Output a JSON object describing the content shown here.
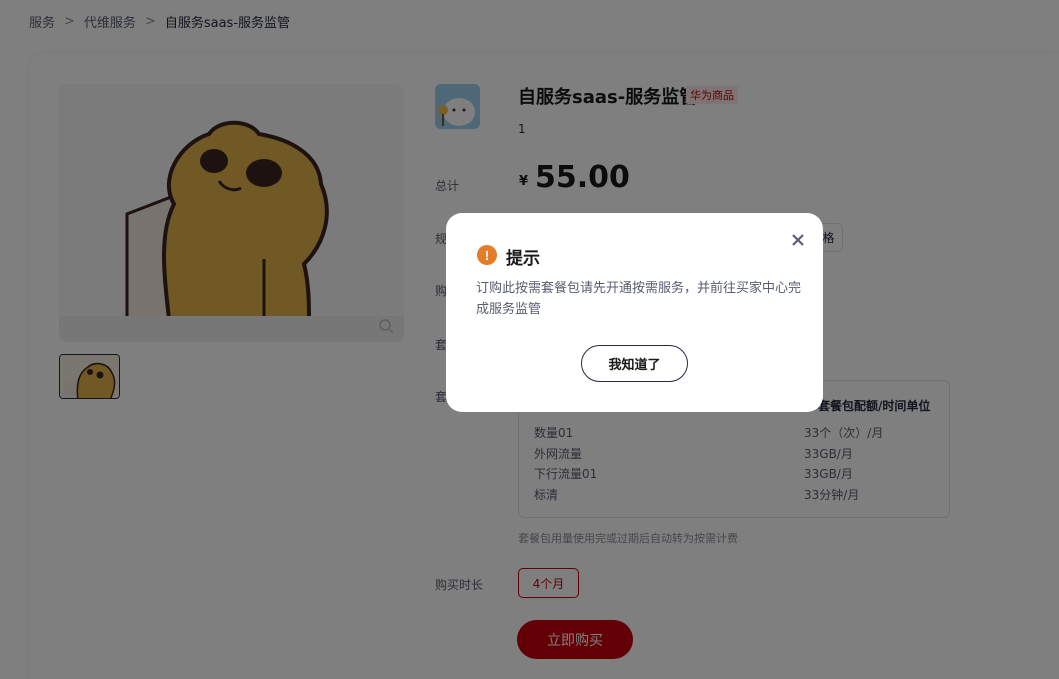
{
  "breadcrumb": {
    "items": [
      "服务",
      "代维服务",
      "自服务saas-服务监管"
    ],
    "separator": ">"
  },
  "product": {
    "title": "自服务saas-服务监管",
    "badge": "华为商品",
    "subtitle": "1",
    "total_label": "总计",
    "currency": "¥",
    "price": "55.00",
    "spec_label_partial": "规",
    "purchase_label_partial": "购",
    "package_label_partial_1": "套",
    "package_label_partial_2": "套",
    "spec_button_partial": "格"
  },
  "package_table": {
    "header_right": "套餐包配额/时间单位",
    "rows": [
      {
        "name": "数量01",
        "value": "33个（次）/月"
      },
      {
        "name": "外网流量",
        "value": "33GB/月"
      },
      {
        "name": "下行流量01",
        "value": "33GB/月"
      },
      {
        "name": "标清",
        "value": "33分钟/月"
      }
    ]
  },
  "note": "套餐包用量使用完或过期后自动转为按需计费",
  "duration": {
    "label": "购买时长",
    "selected": "4个月"
  },
  "buy_button": "立即购买",
  "dialog": {
    "title": "提示",
    "message": "订购此按需套餐包请先开通按需服务，并前往买家中心完成服务监管",
    "ok_button": "我知道了",
    "icon_symbol": "!"
  },
  "colors": {
    "accent": "#c7000b",
    "warning": "#e37d29",
    "overlay": "rgba(0,0,0,0.5)"
  }
}
